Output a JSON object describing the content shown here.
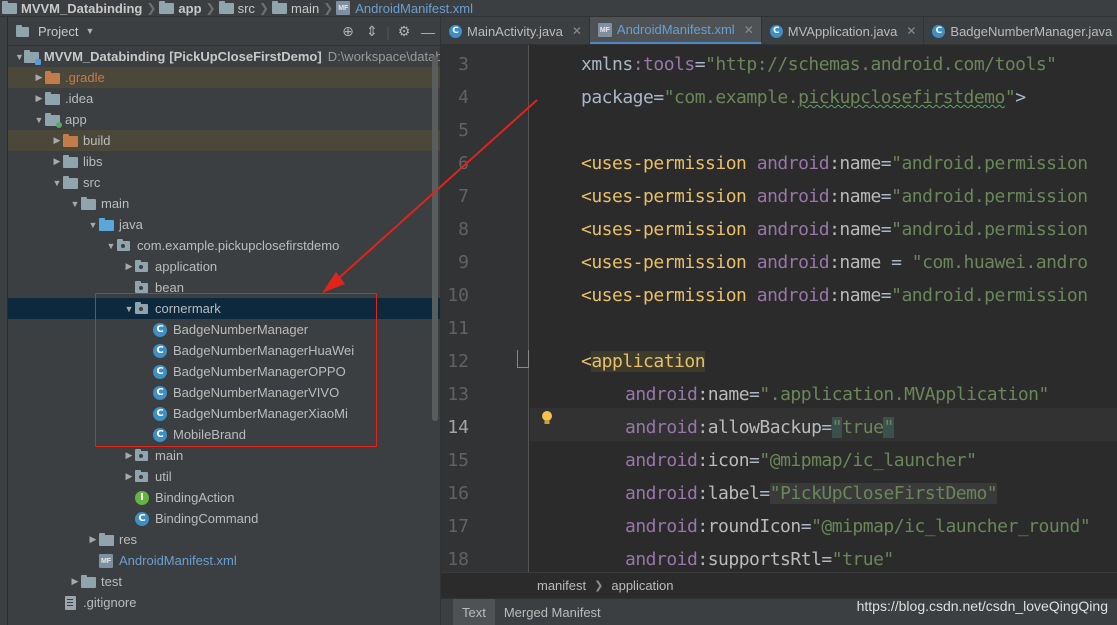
{
  "breadcrumb": {
    "items": [
      {
        "label": "MVVM_Databinding",
        "icon": "folder-icon",
        "bold": true
      },
      {
        "label": "app",
        "icon": "folder-icon",
        "bold": true
      },
      {
        "label": "src",
        "icon": "folder-icon"
      },
      {
        "label": "main",
        "icon": "folder-icon"
      },
      {
        "label": "AndroidManifest.xml",
        "icon": "manifest-file-icon"
      }
    ]
  },
  "project_panel": {
    "title": "Project",
    "tools": [
      "globe-icon",
      "collapse-icon",
      "gear-icon",
      "hide-icon"
    ]
  },
  "tree": [
    {
      "label": "MVVM_Databinding",
      "extra": "[PickUpCloseFirstDemo]",
      "path": "D:\\workspace\\datab",
      "icon": "project-folder-icon",
      "depth": 0,
      "expanded": true
    },
    {
      "label": ".gradle",
      "icon": "folder-orange-icon",
      "depth": 1,
      "expanded": false,
      "style": "gradle"
    },
    {
      "label": ".idea",
      "icon": "folder-icon",
      "depth": 1,
      "expanded": false
    },
    {
      "label": "app",
      "icon": "module-folder-icon",
      "depth": 1,
      "expanded": true
    },
    {
      "label": "build",
      "icon": "folder-orange-icon",
      "depth": 2,
      "expanded": false,
      "style": "build"
    },
    {
      "label": "libs",
      "icon": "folder-icon",
      "depth": 2,
      "expanded": false
    },
    {
      "label": "src",
      "icon": "folder-icon",
      "depth": 2,
      "expanded": true
    },
    {
      "label": "main",
      "icon": "folder-icon",
      "depth": 3,
      "expanded": true
    },
    {
      "label": "java",
      "icon": "folder-blue-icon",
      "depth": 4,
      "expanded": true
    },
    {
      "label": "com.example.pickupclosefirstdemo",
      "icon": "package-icon",
      "depth": 5,
      "expanded": true
    },
    {
      "label": "application",
      "icon": "package-icon",
      "depth": 6,
      "expanded": false
    },
    {
      "label": "bean",
      "icon": "package-icon",
      "depth": 6,
      "leaf": true
    },
    {
      "label": "cornermark",
      "icon": "package-icon",
      "depth": 6,
      "expanded": true,
      "selected": true
    },
    {
      "label": "BadgeNumberManager",
      "icon": "class-icon",
      "depth": 7,
      "leaf": true
    },
    {
      "label": "BadgeNumberManagerHuaWei",
      "icon": "class-icon",
      "depth": 7,
      "leaf": true
    },
    {
      "label": "BadgeNumberManagerOPPO",
      "icon": "class-icon",
      "depth": 7,
      "leaf": true
    },
    {
      "label": "BadgeNumberManagerVIVO",
      "icon": "class-icon",
      "depth": 7,
      "leaf": true
    },
    {
      "label": "BadgeNumberManagerXiaoMi",
      "icon": "class-icon",
      "depth": 7,
      "leaf": true
    },
    {
      "label": "MobileBrand",
      "icon": "class-icon",
      "depth": 7,
      "leaf": true
    },
    {
      "label": "main",
      "icon": "package-icon",
      "depth": 6,
      "expanded": false
    },
    {
      "label": "util",
      "icon": "package-icon",
      "depth": 6,
      "expanded": false
    },
    {
      "label": "BindingAction",
      "icon": "interface-icon",
      "depth": 6,
      "leaf": true
    },
    {
      "label": "BindingCommand",
      "icon": "class-icon",
      "depth": 6,
      "leaf": true
    },
    {
      "label": "res",
      "icon": "folder-icon",
      "depth": 4,
      "expanded": false
    },
    {
      "label": "AndroidManifest.xml",
      "icon": "manifest-file-icon",
      "depth": 4,
      "leaf": true,
      "style": "blue"
    },
    {
      "label": "test",
      "icon": "folder-icon",
      "depth": 3,
      "expanded": false
    },
    {
      "label": ".gitignore",
      "icon": "text-file-icon",
      "depth": 2,
      "leaf": true
    }
  ],
  "editor": {
    "tabs": [
      {
        "label": "MainActivity.java",
        "icon": "class-icon",
        "active": false
      },
      {
        "label": "AndroidManifest.xml",
        "icon": "manifest-file-icon",
        "active": true
      },
      {
        "label": "MVApplication.java",
        "icon": "class-icon",
        "active": false
      },
      {
        "label": "BadgeNumberManager.java",
        "icon": "class-icon",
        "active": false
      }
    ],
    "current_line": 14,
    "lines": [
      {
        "num": 3,
        "indent": 0,
        "tokens": [
          [
            "plain",
            "xmlns"
          ],
          [
            "ns",
            ":"
          ],
          [
            "ns",
            "tools"
          ],
          [
            "plain",
            "="
          ],
          [
            "str",
            "\"http://schemas.android.com/tools\""
          ]
        ]
      },
      {
        "num": 4,
        "indent": 0,
        "tokens": [
          [
            "plain",
            "package"
          ],
          [
            "plain",
            "="
          ],
          [
            "str",
            "\"com.example."
          ],
          [
            "str-u",
            "pickupclosefirstdemo"
          ],
          [
            "str",
            "\""
          ],
          [
            "plain",
            ">"
          ]
        ]
      },
      {
        "num": 5,
        "indent": 0,
        "tokens": []
      },
      {
        "num": 6,
        "indent": 0,
        "tokens": [
          [
            "tag",
            "<uses-permission "
          ],
          [
            "ns",
            "android"
          ],
          [
            "attr",
            ":name"
          ],
          [
            "plain",
            "="
          ],
          [
            "str",
            "\"android.permission"
          ]
        ]
      },
      {
        "num": 7,
        "indent": 0,
        "tokens": [
          [
            "tag",
            "<uses-permission "
          ],
          [
            "ns",
            "android"
          ],
          [
            "attr",
            ":name"
          ],
          [
            "plain",
            "="
          ],
          [
            "str",
            "\"android.permission"
          ]
        ]
      },
      {
        "num": 8,
        "indent": 0,
        "tokens": [
          [
            "tag",
            "<uses-permission "
          ],
          [
            "ns",
            "android"
          ],
          [
            "attr",
            ":name"
          ],
          [
            "plain",
            "="
          ],
          [
            "str",
            "\"android.permission"
          ]
        ]
      },
      {
        "num": 9,
        "indent": 0,
        "tokens": [
          [
            "tag",
            "<uses-permission "
          ],
          [
            "ns",
            "android"
          ],
          [
            "attr",
            ":name"
          ],
          [
            "plain",
            " = "
          ],
          [
            "str",
            "\"com.huawei.andro"
          ]
        ]
      },
      {
        "num": 10,
        "indent": 0,
        "tokens": [
          [
            "tag",
            "<uses-permission "
          ],
          [
            "ns",
            "android"
          ],
          [
            "attr",
            ":name"
          ],
          [
            "plain",
            "="
          ],
          [
            "str",
            "\"android.permission"
          ]
        ]
      },
      {
        "num": 11,
        "indent": 0,
        "tokens": []
      },
      {
        "num": 12,
        "indent": 0,
        "tokens": [
          [
            "tag",
            "<"
          ],
          [
            "app",
            "application"
          ]
        ]
      },
      {
        "num": 13,
        "indent": 1,
        "tokens": [
          [
            "ns",
            "android"
          ],
          [
            "attr",
            ":name"
          ],
          [
            "plain",
            "="
          ],
          [
            "str",
            "\".application.MVApplication\""
          ]
        ]
      },
      {
        "num": 14,
        "indent": 1,
        "tokens": [
          [
            "ns",
            "android"
          ],
          [
            "attr",
            ":allowBackup"
          ],
          [
            "plain",
            "="
          ],
          [
            "str-hl",
            "\""
          ],
          [
            "str",
            "true"
          ],
          [
            "str-hl",
            "\""
          ]
        ]
      },
      {
        "num": 15,
        "indent": 1,
        "tokens": [
          [
            "ns",
            "android"
          ],
          [
            "attr",
            ":icon"
          ],
          [
            "plain",
            "="
          ],
          [
            "str",
            "\"@mipmap/ic_launcher\""
          ]
        ]
      },
      {
        "num": 16,
        "indent": 1,
        "tokens": [
          [
            "ns",
            "android"
          ],
          [
            "attr",
            ":label"
          ],
          [
            "plain",
            "="
          ],
          [
            "str-box",
            "\"PickUpCloseFirstDemo\""
          ]
        ]
      },
      {
        "num": 17,
        "indent": 1,
        "tokens": [
          [
            "ns",
            "android"
          ],
          [
            "attr",
            ":roundIcon"
          ],
          [
            "plain",
            "="
          ],
          [
            "str",
            "\"@mipmap/ic_launcher_round\""
          ]
        ]
      },
      {
        "num": 18,
        "indent": 1,
        "tokens": [
          [
            "ns",
            "android"
          ],
          [
            "attr",
            ":supportsRtl"
          ],
          [
            "plain",
            "="
          ],
          [
            "str",
            "\"true\""
          ]
        ]
      }
    ],
    "breadcrumb": [
      "manifest",
      "application"
    ],
    "bottom_tabs": [
      {
        "label": "Text",
        "active": true
      },
      {
        "label": "Merged Manifest",
        "active": false
      }
    ]
  },
  "watermark": "https://blog.csdn.net/csdn_loveQingQing",
  "colors": {
    "annotation_red": "#e0241c",
    "selection_blue": "#0d293e",
    "xml_tag": "#e8bf6a",
    "xml_string": "#6a8759",
    "xml_namespace": "#9876aa"
  }
}
